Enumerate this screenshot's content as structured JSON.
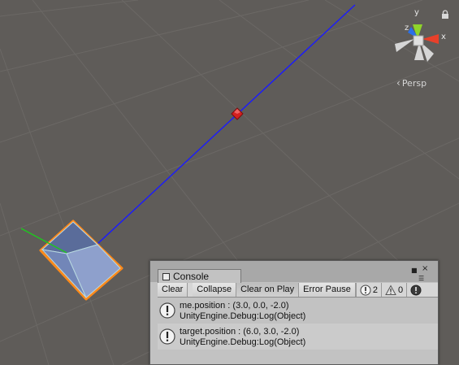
{
  "scene_view": {
    "axis_labels": {
      "x": "x",
      "y": "y",
      "z": "z"
    },
    "projection_label": "Persp",
    "colors": {
      "background": "#5f5c59",
      "grid": "#6d6a67",
      "ray_line": "#1a1aff",
      "target_marker": "#d42020",
      "cube_face": "#7f93c4",
      "cube_outline": "#ff8a1a",
      "forward_axis": "#1ec81e",
      "gizmo_x": "#e8402a",
      "gizmo_y": "#8fd42a",
      "gizmo_z": "#2a70e8"
    }
  },
  "console": {
    "title": "Console",
    "toolbar": {
      "clear": "Clear",
      "collapse": "Collapse",
      "clear_on_play": "Clear on Play",
      "error_pause": "Error Pause"
    },
    "counters": {
      "info": "2",
      "warnings": "0"
    },
    "entries": [
      {
        "message": "me.position : (3.0, 0.0, -2.0)",
        "trace": "UnityEngine.Debug:Log(Object)"
      },
      {
        "message": "target.position : (6.0, 3.0, -2.0)",
        "trace": "UnityEngine.Debug:Log(Object)"
      }
    ]
  }
}
